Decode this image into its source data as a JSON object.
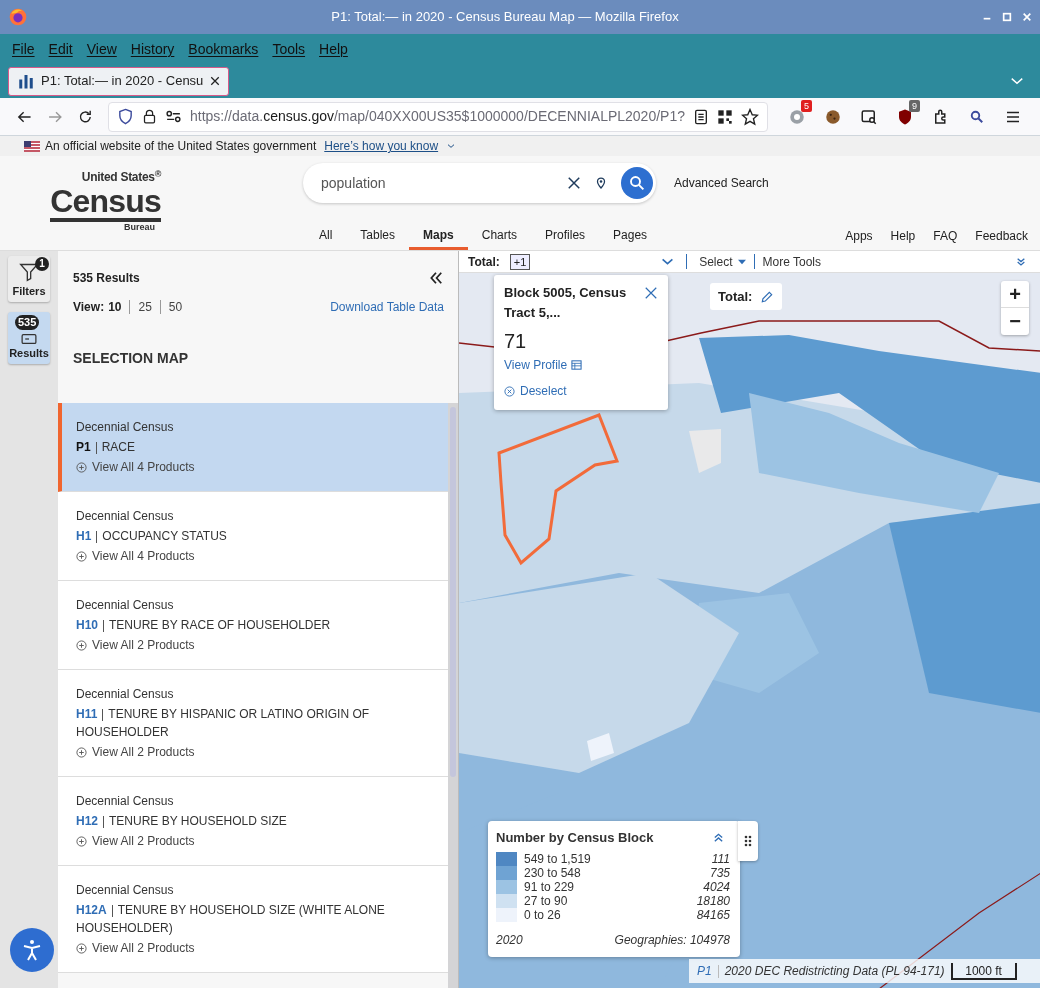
{
  "window": {
    "title": "P1: Total:— in 2020 - Census Bureau Map — Mozilla Firefox"
  },
  "menu": [
    "File",
    "Edit",
    "View",
    "History",
    "Bookmarks",
    "Tools",
    "Help"
  ],
  "tabs": [
    {
      "label": "P1: Total:— in 2020 - Censu",
      "selected": true
    }
  ],
  "address_bar": {
    "scheme_and_subdomain": "https://data.",
    "domain": "census.gov",
    "path": "/map/040XX00US35$1000000/DECENNIALPL2020/P1?"
  },
  "extension_badges": {
    "first": "5",
    "second": "9"
  },
  "gov_banner": {
    "text": "An official website of the United States government",
    "link": "Here’s how you know"
  },
  "logo": {
    "top": "United States$^{®}$",
    "main": "Census",
    "bottom": "Bureau"
  },
  "search": {
    "value": "population",
    "advanced_link": "Advanced Search"
  },
  "nav_tabs": [
    {
      "label": "All",
      "selected": false
    },
    {
      "label": "Tables",
      "selected": false
    },
    {
      "label": "Maps",
      "selected": true
    },
    {
      "label": "Charts",
      "selected": false
    },
    {
      "label": "Profiles",
      "selected": false
    },
    {
      "label": "Pages",
      "selected": false
    }
  ],
  "utility_links": [
    "Apps",
    "Help",
    "FAQ",
    "Feedback"
  ],
  "rail": [
    {
      "label": "Filters",
      "badge": "1",
      "selected": false,
      "kind": "filter"
    },
    {
      "label": "Results",
      "badge": "535",
      "selected": true,
      "kind": "results"
    }
  ],
  "sidebar": {
    "results_count": "535 Results",
    "view_label": "View:",
    "view_options": [
      {
        "label": "10",
        "selected": true
      },
      {
        "label": "25",
        "selected": false
      },
      {
        "label": "50",
        "selected": false
      }
    ],
    "download_link": "Download Table Data",
    "section_title": "SELECTION MAP",
    "results": [
      {
        "program": "Decennial Census",
        "code": "P1",
        "title": "RACE",
        "view_all": "View All 4 Products",
        "selected": true
      },
      {
        "program": "Decennial Census",
        "code": "H1",
        "title": "OCCUPANCY STATUS",
        "view_all": "View All 4 Products",
        "selected": false
      },
      {
        "program": "Decennial Census",
        "code": "H10",
        "title": "TENURE BY RACE OF HOUSEHOLDER",
        "view_all": "View All 2 Products",
        "selected": false
      },
      {
        "program": "Decennial Census",
        "code": "H11",
        "title": "TENURE BY HISPANIC OR LATINO ORIGIN OF HOUSEHOLDER",
        "view_all": "View All 2 Products",
        "selected": false
      },
      {
        "program": "Decennial Census",
        "code": "H12",
        "title": "TENURE BY HOUSEHOLD SIZE",
        "view_all": "View All 2 Products",
        "selected": false
      },
      {
        "program": "Decennial Census",
        "code": "H12A",
        "title": "TENURE BY HOUSEHOLD SIZE (WHITE ALONE HOUSEHOLDER)",
        "view_all": "View All 2 Products",
        "selected": false
      }
    ]
  },
  "map_toolbar": {
    "label": "Total:",
    "count_chip": "+1",
    "select": "Select",
    "more_tools": "More Tools"
  },
  "popup": {
    "title": "Block 5005, Census Tract 5,...",
    "value": "71",
    "view_profile": "View Profile",
    "deselect": "Deselect"
  },
  "total_chip": "Total:",
  "zoom": {
    "in": "+",
    "out": "−"
  },
  "legend": {
    "title": "Number by Census Block",
    "rows": [
      {
        "range": "549 to 1,519",
        "count": "111",
        "color": "#4f87c2"
      },
      {
        "range": "230 to 548",
        "count": "735",
        "color": "#6fa3d3"
      },
      {
        "range": "91 to 229",
        "count": "4024",
        "color": "#9cc3e3"
      },
      {
        "range": "27 to 90",
        "count": "18180",
        "color": "#cfe1f1"
      },
      {
        "range": "0 to 26",
        "count": "84165",
        "color": "#eef3fb"
      }
    ],
    "year": "2020",
    "geographies": "Geographies: 104978"
  },
  "map_footer": {
    "code": "P1",
    "dataset": "2020 DEC Redistricting Data (PL 94-171)",
    "scale": "1000 ft"
  }
}
